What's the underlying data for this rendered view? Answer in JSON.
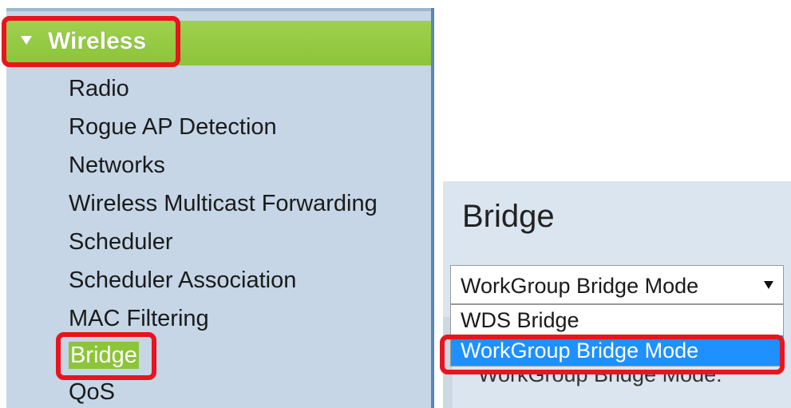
{
  "sidebar": {
    "section_label": "Wireless",
    "items": [
      {
        "label": "Radio"
      },
      {
        "label": "Rogue AP Detection"
      },
      {
        "label": "Networks"
      },
      {
        "label": "Wireless Multicast Forwarding"
      },
      {
        "label": "Scheduler"
      },
      {
        "label": "Scheduler Association"
      },
      {
        "label": "MAC Filtering"
      },
      {
        "label": "Bridge",
        "active": true
      },
      {
        "label": "QoS"
      }
    ]
  },
  "panel": {
    "title": "Bridge",
    "select_value": "WorkGroup Bridge Mode",
    "options": [
      "WDS Bridge",
      "WorkGroup Bridge Mode"
    ],
    "highlighted_option": "WorkGroup Bridge Mode",
    "obscured_text": "WorkGroup Bridge Mode:"
  },
  "colors": {
    "sidebar_bg": "#c6d6e6",
    "section_header": "#8cc43a",
    "highlight_outline": "#e8141e",
    "option_selected": "#1e90ff"
  },
  "icons": {
    "section_toggle": "triangle-down-icon",
    "select_arrow": "triangle-down-icon"
  }
}
